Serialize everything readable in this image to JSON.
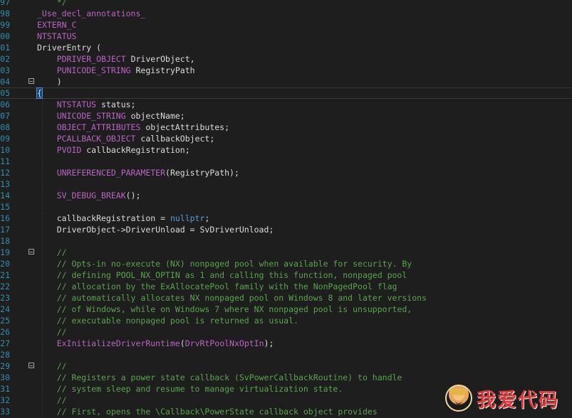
{
  "editor": {
    "lines": [
      {
        "n": "97",
        "fold": false,
        "current": false,
        "tokens": [
          {
            "t": "    */",
            "c": "cmt"
          }
        ]
      },
      {
        "n": "98",
        "fold": false,
        "current": false,
        "tokens": [
          {
            "t": "_Use_decl_annotations_",
            "c": "macro"
          }
        ]
      },
      {
        "n": "99",
        "fold": false,
        "current": false,
        "tokens": [
          {
            "t": "EXTERN_C",
            "c": "macro"
          }
        ]
      },
      {
        "n": "00",
        "fold": false,
        "current": false,
        "tokens": [
          {
            "t": "NTSTATUS",
            "c": "macro"
          }
        ]
      },
      {
        "n": "01",
        "fold": false,
        "current": false,
        "tokens": [
          {
            "t": "DriverEntry (",
            "c": "plain"
          }
        ]
      },
      {
        "n": "02",
        "fold": false,
        "current": false,
        "tokens": [
          {
            "t": "    ",
            "c": "plain"
          },
          {
            "t": "PDRIVER_OBJECT",
            "c": "macro"
          },
          {
            "t": " DriverObject,",
            "c": "plain"
          }
        ]
      },
      {
        "n": "03",
        "fold": false,
        "current": false,
        "tokens": [
          {
            "t": "    ",
            "c": "plain"
          },
          {
            "t": "PUNICODE_STRING",
            "c": "macro"
          },
          {
            "t": " RegistryPath",
            "c": "plain"
          }
        ]
      },
      {
        "n": "04",
        "fold": true,
        "current": false,
        "tokens": [
          {
            "t": "    )",
            "c": "plain"
          }
        ]
      },
      {
        "n": "05",
        "fold": false,
        "current": true,
        "tokens": [
          {
            "t": "{",
            "c": "brace"
          }
        ]
      },
      {
        "n": "06",
        "fold": false,
        "current": false,
        "tokens": [
          {
            "t": "    ",
            "c": "plain"
          },
          {
            "t": "NTSTATUS",
            "c": "macro"
          },
          {
            "t": " status;",
            "c": "plain"
          }
        ]
      },
      {
        "n": "07",
        "fold": false,
        "current": false,
        "tokens": [
          {
            "t": "    ",
            "c": "plain"
          },
          {
            "t": "UNICODE_STRING",
            "c": "macro"
          },
          {
            "t": " objectName;",
            "c": "plain"
          }
        ]
      },
      {
        "n": "08",
        "fold": false,
        "current": false,
        "tokens": [
          {
            "t": "    ",
            "c": "plain"
          },
          {
            "t": "OBJECT_ATTRIBUTES",
            "c": "macro"
          },
          {
            "t": " objectAttributes;",
            "c": "plain"
          }
        ]
      },
      {
        "n": "09",
        "fold": false,
        "current": false,
        "tokens": [
          {
            "t": "    ",
            "c": "plain"
          },
          {
            "t": "PCALLBACK_OBJECT",
            "c": "macro"
          },
          {
            "t": " callbackObject;",
            "c": "plain"
          }
        ]
      },
      {
        "n": "10",
        "fold": false,
        "current": false,
        "tokens": [
          {
            "t": "    ",
            "c": "plain"
          },
          {
            "t": "PVOID",
            "c": "macro"
          },
          {
            "t": " callbackRegistration;",
            "c": "plain"
          }
        ]
      },
      {
        "n": "11",
        "fold": false,
        "current": false,
        "tokens": []
      },
      {
        "n": "12",
        "fold": false,
        "current": false,
        "tokens": [
          {
            "t": "    ",
            "c": "plain"
          },
          {
            "t": "UNREFERENCED_PARAMETER",
            "c": "macro"
          },
          {
            "t": "(RegistryPath);",
            "c": "plain"
          }
        ]
      },
      {
        "n": "13",
        "fold": false,
        "current": false,
        "tokens": []
      },
      {
        "n": "14",
        "fold": false,
        "current": false,
        "tokens": [
          {
            "t": "    ",
            "c": "plain"
          },
          {
            "t": "SV_DEBUG_BREAK",
            "c": "macro"
          },
          {
            "t": "();",
            "c": "plain"
          }
        ]
      },
      {
        "n": "15",
        "fold": false,
        "current": false,
        "tokens": []
      },
      {
        "n": "16",
        "fold": false,
        "current": false,
        "tokens": [
          {
            "t": "    callbackRegistration = ",
            "c": "plain"
          },
          {
            "t": "nullptr",
            "c": "kw"
          },
          {
            "t": ";",
            "c": "plain"
          }
        ]
      },
      {
        "n": "17",
        "fold": false,
        "current": false,
        "tokens": [
          {
            "t": "    DriverObject->DriverUnload = SvDriverUnload;",
            "c": "plain"
          }
        ]
      },
      {
        "n": "18",
        "fold": false,
        "current": false,
        "tokens": []
      },
      {
        "n": "19",
        "fold": true,
        "current": false,
        "tokens": [
          {
            "t": "    //",
            "c": "cmt"
          }
        ]
      },
      {
        "n": "20",
        "fold": false,
        "current": false,
        "tokens": [
          {
            "t": "    // Opts-in no-execute (NX) nonpaged pool when available for security. By",
            "c": "cmt"
          }
        ]
      },
      {
        "n": "21",
        "fold": false,
        "current": false,
        "tokens": [
          {
            "t": "    // defining POOL_NX_OPTIN as 1 and calling this function, nonpaged pool",
            "c": "cmt"
          }
        ]
      },
      {
        "n": "22",
        "fold": false,
        "current": false,
        "tokens": [
          {
            "t": "    // allocation by the ExAllocatePool family with the NonPagedPool flag",
            "c": "cmt"
          }
        ]
      },
      {
        "n": "23",
        "fold": false,
        "current": false,
        "tokens": [
          {
            "t": "    // automatically allocates NX nonpaged pool on Windows 8 and later versions",
            "c": "cmt"
          }
        ]
      },
      {
        "n": "24",
        "fold": false,
        "current": false,
        "tokens": [
          {
            "t": "    // of Windows, while on Windows 7 where NX nonpaged pool is unsupported,",
            "c": "cmt"
          }
        ]
      },
      {
        "n": "25",
        "fold": false,
        "current": false,
        "tokens": [
          {
            "t": "    // executable nonpaged pool is returned as usual.",
            "c": "cmt"
          }
        ]
      },
      {
        "n": "26",
        "fold": false,
        "current": false,
        "tokens": [
          {
            "t": "    //",
            "c": "cmt"
          }
        ]
      },
      {
        "n": "27",
        "fold": false,
        "current": false,
        "tokens": [
          {
            "t": "    ",
            "c": "plain"
          },
          {
            "t": "ExInitializeDriverRuntime",
            "c": "macro"
          },
          {
            "t": "(",
            "c": "plain"
          },
          {
            "t": "DrvRtPoolNxOptIn",
            "c": "macro"
          },
          {
            "t": ");",
            "c": "plain"
          }
        ]
      },
      {
        "n": "28",
        "fold": false,
        "current": false,
        "tokens": []
      },
      {
        "n": "29",
        "fold": true,
        "current": false,
        "tokens": [
          {
            "t": "    //",
            "c": "cmt"
          }
        ]
      },
      {
        "n": "30",
        "fold": false,
        "current": false,
        "tokens": [
          {
            "t": "    // Registers a power state callback (SvPowerCallbackRoutine) to handle",
            "c": "cmt"
          }
        ]
      },
      {
        "n": "31",
        "fold": false,
        "current": false,
        "tokens": [
          {
            "t": "    // system sleep and resume to manage virtualization state.",
            "c": "cmt"
          }
        ]
      },
      {
        "n": "32",
        "fold": false,
        "current": false,
        "tokens": [
          {
            "t": "    //",
            "c": "cmt"
          }
        ]
      },
      {
        "n": "33",
        "fold": false,
        "current": false,
        "tokens": [
          {
            "t": "    // First, opens the \\Callback\\PowerState callback object provides",
            "c": "cmt"
          }
        ]
      }
    ]
  },
  "watermark": {
    "text": "我爱代码"
  }
}
